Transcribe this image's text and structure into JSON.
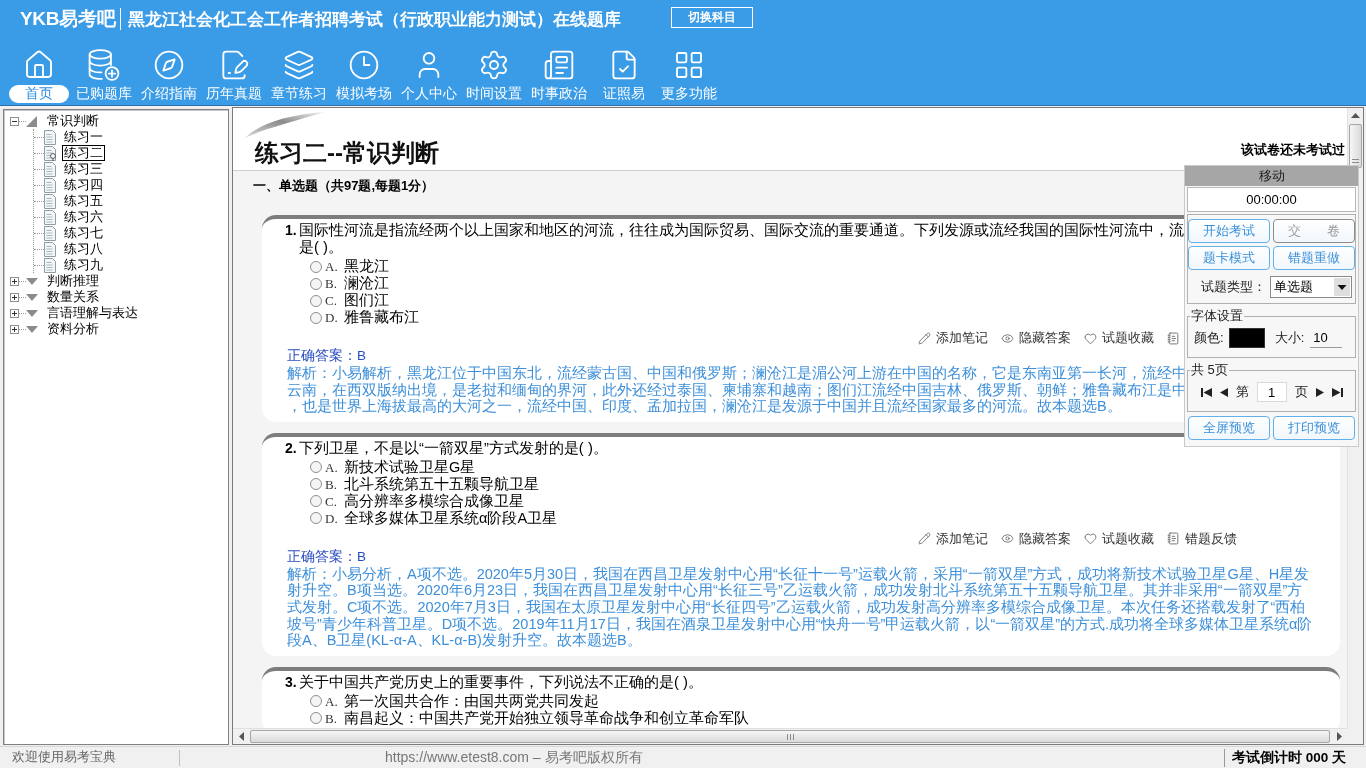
{
  "header": {
    "logo": "YKB易考吧",
    "title": "黑龙江社会化工会工作者招聘考试（行政职业能力测试）在线题库",
    "switch_button": "切换科目"
  },
  "toolbar": [
    {
      "kind": "home",
      "label": "首页",
      "selected": true
    },
    {
      "kind": "purchased",
      "label": "已购题库",
      "selected": false
    },
    {
      "kind": "guide",
      "label": "介绍指南",
      "selected": false
    },
    {
      "kind": "past_papers",
      "label": "历年真题",
      "selected": false
    },
    {
      "kind": "chapters",
      "label": "章节练习",
      "selected": false
    },
    {
      "kind": "mock_exam",
      "label": "模拟考场",
      "selected": false
    },
    {
      "kind": "profile",
      "label": "个人中心",
      "selected": false
    },
    {
      "kind": "time_settings",
      "label": "时间设置",
      "selected": false
    },
    {
      "kind": "news",
      "label": "时事政治",
      "selected": false
    },
    {
      "kind": "certificate",
      "label": "证照易",
      "selected": false
    },
    {
      "kind": "more",
      "label": "更多功能",
      "selected": false
    }
  ],
  "tree": [
    {
      "label": "常识判断",
      "expanded": true,
      "children": [
        {
          "label": "练习一",
          "selected": false
        },
        {
          "label": "练习二",
          "selected": true
        },
        {
          "label": "练习三",
          "selected": false
        },
        {
          "label": "练习四",
          "selected": false
        },
        {
          "label": "练习五",
          "selected": false
        },
        {
          "label": "练习六",
          "selected": false
        },
        {
          "label": "练习七",
          "selected": false
        },
        {
          "label": "练习八",
          "selected": false
        },
        {
          "label": "练习九",
          "selected": false
        }
      ]
    },
    {
      "label": "判断推理",
      "expanded": false
    },
    {
      "label": "数量关系",
      "expanded": false
    },
    {
      "label": "言语理解与表达",
      "expanded": false
    },
    {
      "label": "资料分析",
      "expanded": false
    }
  ],
  "paper": {
    "title": "练习二--常识判断",
    "status": "该试卷还未考试过",
    "section": "一、单选题（共97题,每题1分）"
  },
  "questions": [
    {
      "number": "1.",
      "stem": [
        "国际性河流是指流经两个以上国家和地区的河流，往往成为国际贸易、国际交流的重要通道。下列发源或流经我国的国际性河流中，流",
        "是( )。"
      ],
      "options": [
        {
          "letter": "A.",
          "text": "黑龙江",
          "selected": false
        },
        {
          "letter": "B.",
          "text": "澜沧江",
          "selected": false
        },
        {
          "letter": "C.",
          "text": "图们江",
          "selected": false
        },
        {
          "letter": "D.",
          "text": "雅鲁藏布江",
          "selected": false
        }
      ],
      "actions": [
        {
          "kind": "note",
          "label": "添加笔记"
        },
        {
          "kind": "hide",
          "label": "隐藏答案"
        },
        {
          "kind": "favorite",
          "label": "试题收藏"
        },
        {
          "kind": "feedback"
        }
      ],
      "answer": "正确答案：B",
      "explanation": [
        "解析：小易解析，黑龙江位于中国东北，流经蒙古国、中国和俄罗斯；澜沧江是湄公河上游在中国的名称，它是东南亚第一长河，流经中",
        "云南，在西双版纳出境，是老挝和缅甸的界河，此外还经过泰国、柬埔寨和越南；图们江流经中国吉林、俄罗斯、朝鲜；雅鲁藏布江是中",
        "，也是世界上海拔最高的大河之一，流经中国、印度、孟加拉国，澜沧江是发源于中国并且流经国家最多的河流。故本题选B。"
      ]
    },
    {
      "number": "2.",
      "stem": [
        "下列卫星，不是以“一箭双星”方式发射的是( )。"
      ],
      "options": [
        {
          "letter": "A.",
          "text": "新技术试验卫星G星",
          "selected": false
        },
        {
          "letter": "B.",
          "text": "北斗系统第五十五颗导航卫星",
          "selected": false
        },
        {
          "letter": "C.",
          "text": "高分辨率多模综合成像卫星",
          "selected": false
        },
        {
          "letter": "D.",
          "text": "全球多媒体卫星系统α阶段A卫星",
          "selected": false
        }
      ],
      "actions": [
        {
          "kind": "note",
          "label": "添加笔记"
        },
        {
          "kind": "hide",
          "label": "隐藏答案"
        },
        {
          "kind": "favorite",
          "label": "试题收藏"
        },
        {
          "kind": "feedback",
          "label": "错题反馈"
        }
      ],
      "answer": "正确答案：B",
      "explanation": [
        "解析：小易分析，A项不选。2020年5月30日，我国在西昌卫星发射中心用“长征十一号”运载火箭，采用“一箭双星”方式，成功将新技术试验卫星G星、H星发",
        "射升空。B项当选。2020年6月23日，我国在西昌卫星发射中心用“长征三号”乙运载火箭，成功发射北斗系统第五十五颗导航卫星。其并非采用“一箭双星”方",
        "式发射。C项不选。2020年7月3日，我国在太原卫星发射中心用“长征四号”乙运载火箭，成功发射高分辨率多模综合成像卫星。本次任务还搭载发射了“西柏",
        "坡号”青少年科普卫星。D项不选。2019年11月17日，我国在酒泉卫星发射中心用“快舟一号”甲运载火箭，以“一箭双星”的方式.成功将全球多媒体卫星系统α阶",
        "段A、B卫星(KL-α-A、KL-α-B)发射升空。故本题选B。"
      ]
    },
    {
      "number": "3.",
      "stem": [
        "关于中国共产党历史上的重要事件，下列说法不正确的是( )。"
      ],
      "options": [
        {
          "letter": "A.",
          "text": "第一次国共合作：由国共两党共同发起",
          "selected": false
        },
        {
          "letter": "B.",
          "text": "南昌起义：中国共产党开始独立领导革命战争和创立革命军队",
          "selected": false
        }
      ]
    }
  ],
  "panel": {
    "drag_label": "移动",
    "timer": "00:00:00",
    "buttons": [
      {
        "label": "开始考试",
        "disabled": false
      },
      {
        "label": "交　　卷",
        "disabled": true
      },
      {
        "label": "题卡模式",
        "disabled": false
      },
      {
        "label": "错题重做",
        "disabled": false
      }
    ],
    "type_label": "试题类型：",
    "type_value": "单选题",
    "font": {
      "legend": "字体设置",
      "color_label": "颜色:",
      "color": "#000000",
      "size_label": "大小:",
      "size": "10"
    },
    "pager": {
      "legend": "共 5页",
      "before": "第",
      "page": "1",
      "after": "页"
    },
    "previews": [
      "全屏预览",
      "打印预览"
    ]
  },
  "status_bar": {
    "welcome": "欢迎使用易考宝典",
    "site": "https://www.etest8.com – 易考吧版权所有",
    "countdown": "考试倒计时 000 天"
  }
}
